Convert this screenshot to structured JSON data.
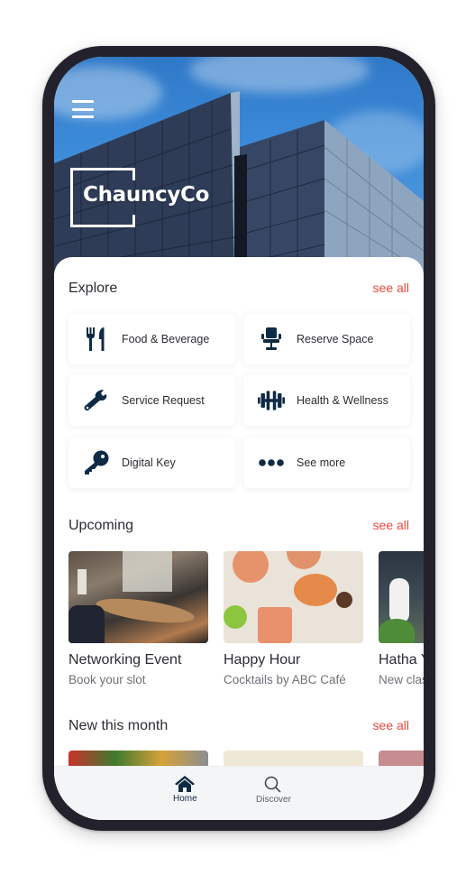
{
  "app": {
    "brand": "ChauncyCo"
  },
  "header": {
    "menu_icon": "hamburger-menu-icon"
  },
  "explore": {
    "title": "Explore",
    "see_all": "see all",
    "items": [
      {
        "label": "Food & Beverage",
        "icon": "utensils-icon"
      },
      {
        "label": "Reserve Space",
        "icon": "chair-icon"
      },
      {
        "label": "Service Request",
        "icon": "wrench-icon"
      },
      {
        "label": "Health & Wellness",
        "icon": "dumbbell-icon"
      },
      {
        "label": "Digital Key",
        "icon": "key-icon"
      },
      {
        "label": "See more",
        "icon": "more-dots-icon"
      }
    ]
  },
  "upcoming": {
    "title": "Upcoming",
    "see_all": "see all",
    "cards": [
      {
        "title": "Networking Event",
        "subtitle": "Book your slot",
        "image": "meeting-room-photo"
      },
      {
        "title": "Happy Hour",
        "subtitle": "Cocktails by ABC Café",
        "image": "cocktails-photo"
      },
      {
        "title": "Hatha Yoga",
        "subtitle": "New class",
        "image": "yoga-photo"
      }
    ]
  },
  "new_this_month": {
    "title": "New this month",
    "see_all": "see all"
  },
  "bottom_nav": {
    "items": [
      {
        "label": "Home",
        "icon": "home-icon",
        "active": true
      },
      {
        "label": "Discover",
        "icon": "search-icon",
        "active": false
      }
    ]
  },
  "colors": {
    "accent": "#f0483e",
    "icon_primary": "#0f2a44",
    "text_primary": "#2b2d33",
    "text_secondary": "#6e7178",
    "frame": "#23222c"
  }
}
